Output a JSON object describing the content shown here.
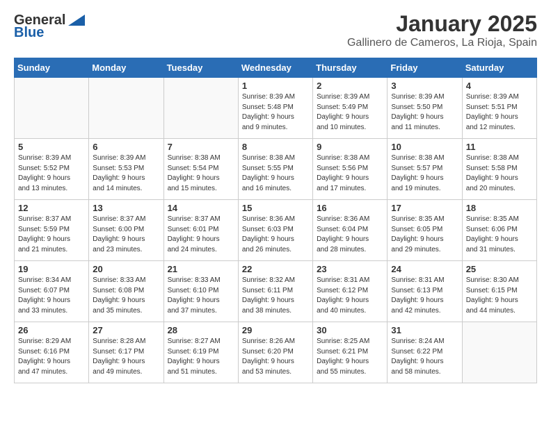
{
  "header": {
    "logo_line1": "General",
    "logo_line2": "Blue",
    "title": "January 2025",
    "subtitle": "Gallinero de Cameros, La Rioja, Spain"
  },
  "weekdays": [
    "Sunday",
    "Monday",
    "Tuesday",
    "Wednesday",
    "Thursday",
    "Friday",
    "Saturday"
  ],
  "weeks": [
    [
      {
        "day": "",
        "info": ""
      },
      {
        "day": "",
        "info": ""
      },
      {
        "day": "",
        "info": ""
      },
      {
        "day": "1",
        "info": "Sunrise: 8:39 AM\nSunset: 5:48 PM\nDaylight: 9 hours\nand 9 minutes."
      },
      {
        "day": "2",
        "info": "Sunrise: 8:39 AM\nSunset: 5:49 PM\nDaylight: 9 hours\nand 10 minutes."
      },
      {
        "day": "3",
        "info": "Sunrise: 8:39 AM\nSunset: 5:50 PM\nDaylight: 9 hours\nand 11 minutes."
      },
      {
        "day": "4",
        "info": "Sunrise: 8:39 AM\nSunset: 5:51 PM\nDaylight: 9 hours\nand 12 minutes."
      }
    ],
    [
      {
        "day": "5",
        "info": "Sunrise: 8:39 AM\nSunset: 5:52 PM\nDaylight: 9 hours\nand 13 minutes."
      },
      {
        "day": "6",
        "info": "Sunrise: 8:39 AM\nSunset: 5:53 PM\nDaylight: 9 hours\nand 14 minutes."
      },
      {
        "day": "7",
        "info": "Sunrise: 8:38 AM\nSunset: 5:54 PM\nDaylight: 9 hours\nand 15 minutes."
      },
      {
        "day": "8",
        "info": "Sunrise: 8:38 AM\nSunset: 5:55 PM\nDaylight: 9 hours\nand 16 minutes."
      },
      {
        "day": "9",
        "info": "Sunrise: 8:38 AM\nSunset: 5:56 PM\nDaylight: 9 hours\nand 17 minutes."
      },
      {
        "day": "10",
        "info": "Sunrise: 8:38 AM\nSunset: 5:57 PM\nDaylight: 9 hours\nand 19 minutes."
      },
      {
        "day": "11",
        "info": "Sunrise: 8:38 AM\nSunset: 5:58 PM\nDaylight: 9 hours\nand 20 minutes."
      }
    ],
    [
      {
        "day": "12",
        "info": "Sunrise: 8:37 AM\nSunset: 5:59 PM\nDaylight: 9 hours\nand 21 minutes."
      },
      {
        "day": "13",
        "info": "Sunrise: 8:37 AM\nSunset: 6:00 PM\nDaylight: 9 hours\nand 23 minutes."
      },
      {
        "day": "14",
        "info": "Sunrise: 8:37 AM\nSunset: 6:01 PM\nDaylight: 9 hours\nand 24 minutes."
      },
      {
        "day": "15",
        "info": "Sunrise: 8:36 AM\nSunset: 6:03 PM\nDaylight: 9 hours\nand 26 minutes."
      },
      {
        "day": "16",
        "info": "Sunrise: 8:36 AM\nSunset: 6:04 PM\nDaylight: 9 hours\nand 28 minutes."
      },
      {
        "day": "17",
        "info": "Sunrise: 8:35 AM\nSunset: 6:05 PM\nDaylight: 9 hours\nand 29 minutes."
      },
      {
        "day": "18",
        "info": "Sunrise: 8:35 AM\nSunset: 6:06 PM\nDaylight: 9 hours\nand 31 minutes."
      }
    ],
    [
      {
        "day": "19",
        "info": "Sunrise: 8:34 AM\nSunset: 6:07 PM\nDaylight: 9 hours\nand 33 minutes."
      },
      {
        "day": "20",
        "info": "Sunrise: 8:33 AM\nSunset: 6:08 PM\nDaylight: 9 hours\nand 35 minutes."
      },
      {
        "day": "21",
        "info": "Sunrise: 8:33 AM\nSunset: 6:10 PM\nDaylight: 9 hours\nand 37 minutes."
      },
      {
        "day": "22",
        "info": "Sunrise: 8:32 AM\nSunset: 6:11 PM\nDaylight: 9 hours\nand 38 minutes."
      },
      {
        "day": "23",
        "info": "Sunrise: 8:31 AM\nSunset: 6:12 PM\nDaylight: 9 hours\nand 40 minutes."
      },
      {
        "day": "24",
        "info": "Sunrise: 8:31 AM\nSunset: 6:13 PM\nDaylight: 9 hours\nand 42 minutes."
      },
      {
        "day": "25",
        "info": "Sunrise: 8:30 AM\nSunset: 6:15 PM\nDaylight: 9 hours\nand 44 minutes."
      }
    ],
    [
      {
        "day": "26",
        "info": "Sunrise: 8:29 AM\nSunset: 6:16 PM\nDaylight: 9 hours\nand 47 minutes."
      },
      {
        "day": "27",
        "info": "Sunrise: 8:28 AM\nSunset: 6:17 PM\nDaylight: 9 hours\nand 49 minutes."
      },
      {
        "day": "28",
        "info": "Sunrise: 8:27 AM\nSunset: 6:19 PM\nDaylight: 9 hours\nand 51 minutes."
      },
      {
        "day": "29",
        "info": "Sunrise: 8:26 AM\nSunset: 6:20 PM\nDaylight: 9 hours\nand 53 minutes."
      },
      {
        "day": "30",
        "info": "Sunrise: 8:25 AM\nSunset: 6:21 PM\nDaylight: 9 hours\nand 55 minutes."
      },
      {
        "day": "31",
        "info": "Sunrise: 8:24 AM\nSunset: 6:22 PM\nDaylight: 9 hours\nand 58 minutes."
      },
      {
        "day": "",
        "info": ""
      }
    ]
  ]
}
